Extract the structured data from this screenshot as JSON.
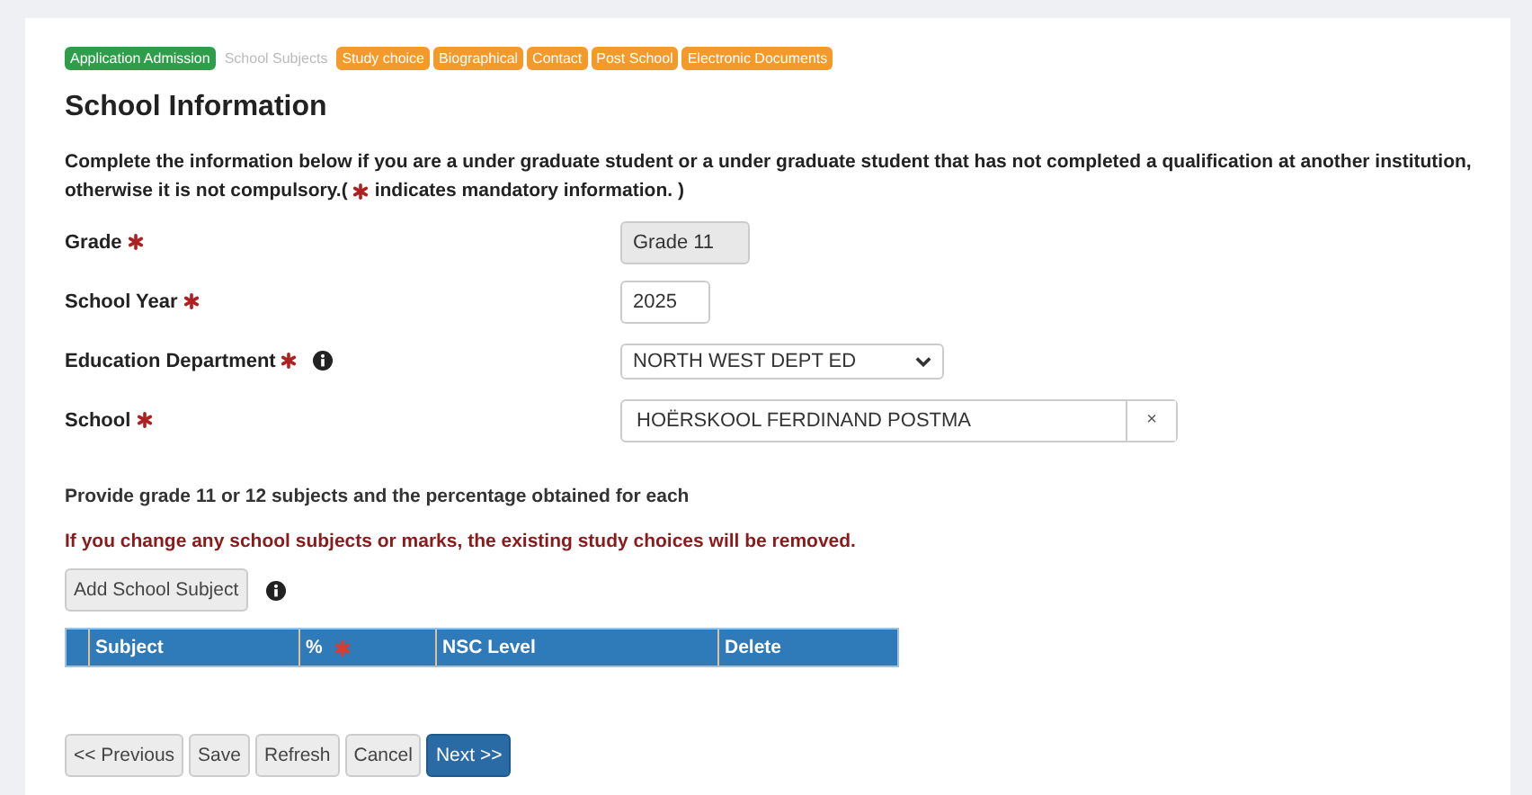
{
  "steps": [
    {
      "label": "Application Admission",
      "color": "#2e9e4a",
      "selected": false
    },
    {
      "label": "School Subjects",
      "selected": true
    },
    {
      "label": "Study choice",
      "color": "#f39a2b",
      "selected": false
    },
    {
      "label": "Biographical",
      "color": "#f39a2b",
      "selected": false
    },
    {
      "label": "Contact",
      "color": "#f39a2b",
      "selected": false
    },
    {
      "label": "Post School",
      "color": "#f39a2b",
      "selected": false
    },
    {
      "label": "Electronic Documents",
      "color": "#f39a2b",
      "selected": false
    }
  ],
  "heading": "School Information",
  "intro": {
    "before": "Complete the information below if you are a under graduate student or a under graduate student that has not completed a qualification at another institution, otherwise it is not compulsory.(",
    "after": "indicates mandatory information. )"
  },
  "fields": [
    {
      "label": "Grade",
      "kind": "text",
      "value": "Grade 11",
      "disabled": true,
      "info": false
    },
    {
      "label": "School Year",
      "kind": "text",
      "value": "2025",
      "disabled": false,
      "info": false
    },
    {
      "label": "Education Department",
      "kind": "select",
      "value": "NORTH WEST DEPT ED",
      "disabled": false,
      "info": true
    },
    {
      "label": "School",
      "kind": "clearable",
      "value": "HOËRSKOOL FERDINAND POSTMA",
      "clear": "×",
      "disabled": false,
      "info": false
    }
  ],
  "subjects_hint": "Provide grade 11 or 12 subjects and the percentage obtained for each",
  "warning": "If you change any school subjects or marks, the existing study choices will be removed.",
  "add_button": "Add School Subject",
  "table": {
    "columns": [
      {
        "label": "Subject",
        "required": false
      },
      {
        "label": "%",
        "required": true
      },
      {
        "label": "NSC Level",
        "required": false
      },
      {
        "label": "Delete",
        "required": false
      }
    ]
  },
  "buttons": [
    {
      "label": "<< Previous",
      "kind": "plain"
    },
    {
      "label": "Save",
      "kind": "plain"
    },
    {
      "label": "Refresh",
      "kind": "plain"
    },
    {
      "label": "Cancel",
      "kind": "plain"
    },
    {
      "label": "Next >>",
      "kind": "primary"
    }
  ]
}
